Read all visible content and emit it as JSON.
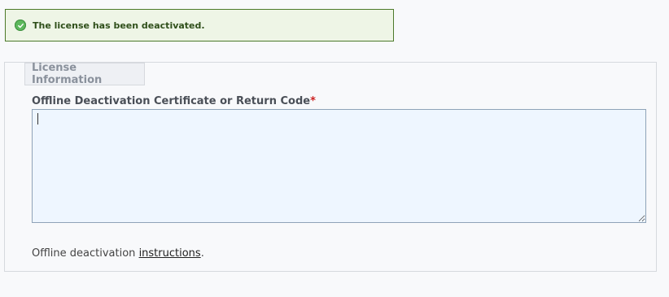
{
  "alert": {
    "message": "The license has been deactivated.",
    "icon": "check-circle-icon",
    "color": "#4c7a2a"
  },
  "license_section": {
    "legend": "License Information",
    "field": {
      "label": "Offline Deactivation Certificate or Return Code",
      "required_marker": "*",
      "value": ""
    },
    "instructions": {
      "prefix": "Offline deactivation ",
      "link_text": "instructions",
      "suffix": "."
    }
  }
}
